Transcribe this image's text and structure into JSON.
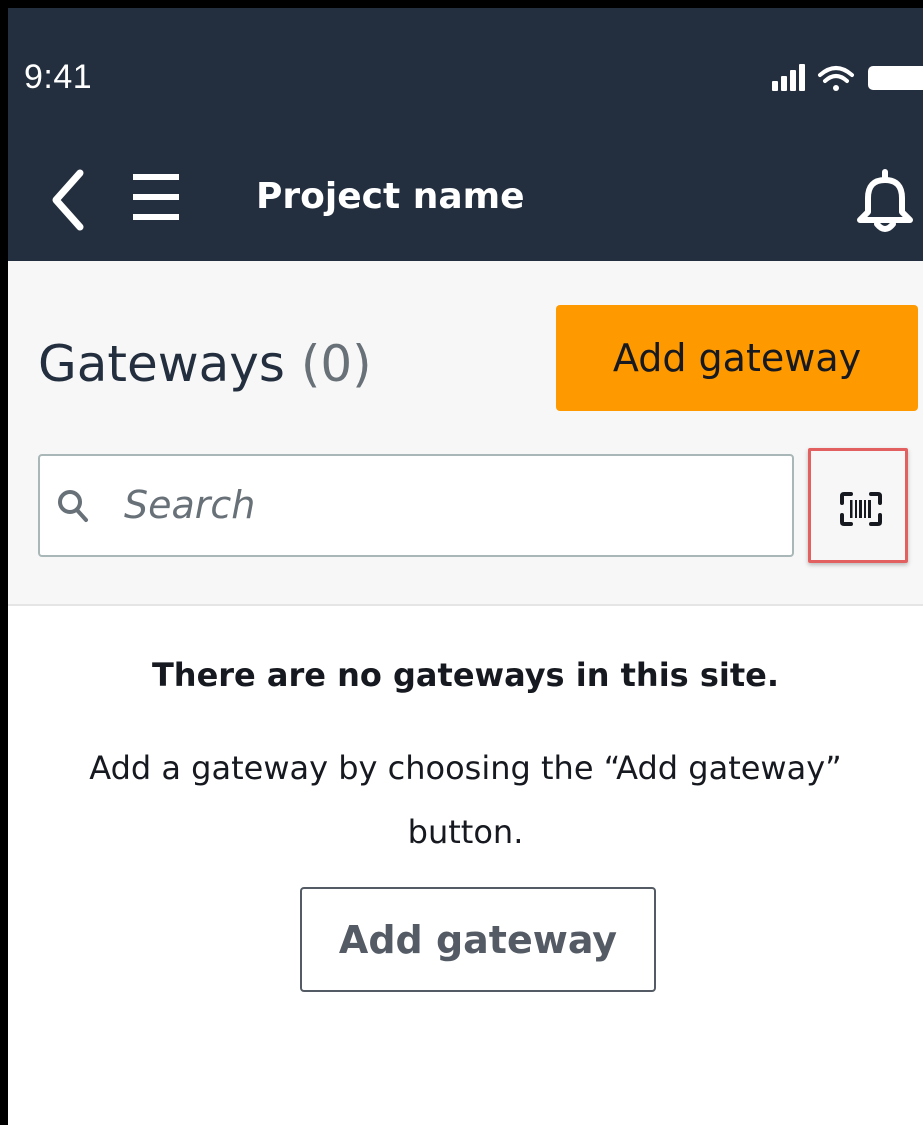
{
  "status_bar": {
    "time": "9:41",
    "icons": [
      "signal-icon",
      "wifi-icon",
      "battery-icon"
    ]
  },
  "nav": {
    "back_icon": "chevron-left-icon",
    "menu_icon": "hamburger-menu-icon",
    "title": "Project name",
    "notification_icon": "bell-icon"
  },
  "header": {
    "title": "Gateways",
    "count": "(0)",
    "add_button_label": "Add gateway"
  },
  "search": {
    "placeholder": "Search",
    "value": "",
    "scan_icon": "barcode-scan-icon"
  },
  "empty_state": {
    "heading": "There are no gateways in this site.",
    "message": "Add a gateway by choosing the “Add gateway” button.",
    "button_label": "Add gateway"
  },
  "colors": {
    "nav_background": "#232f3e",
    "primary_button": "#ff9900",
    "highlight_border": "#e36060",
    "header_background": "#f7f7f7"
  }
}
